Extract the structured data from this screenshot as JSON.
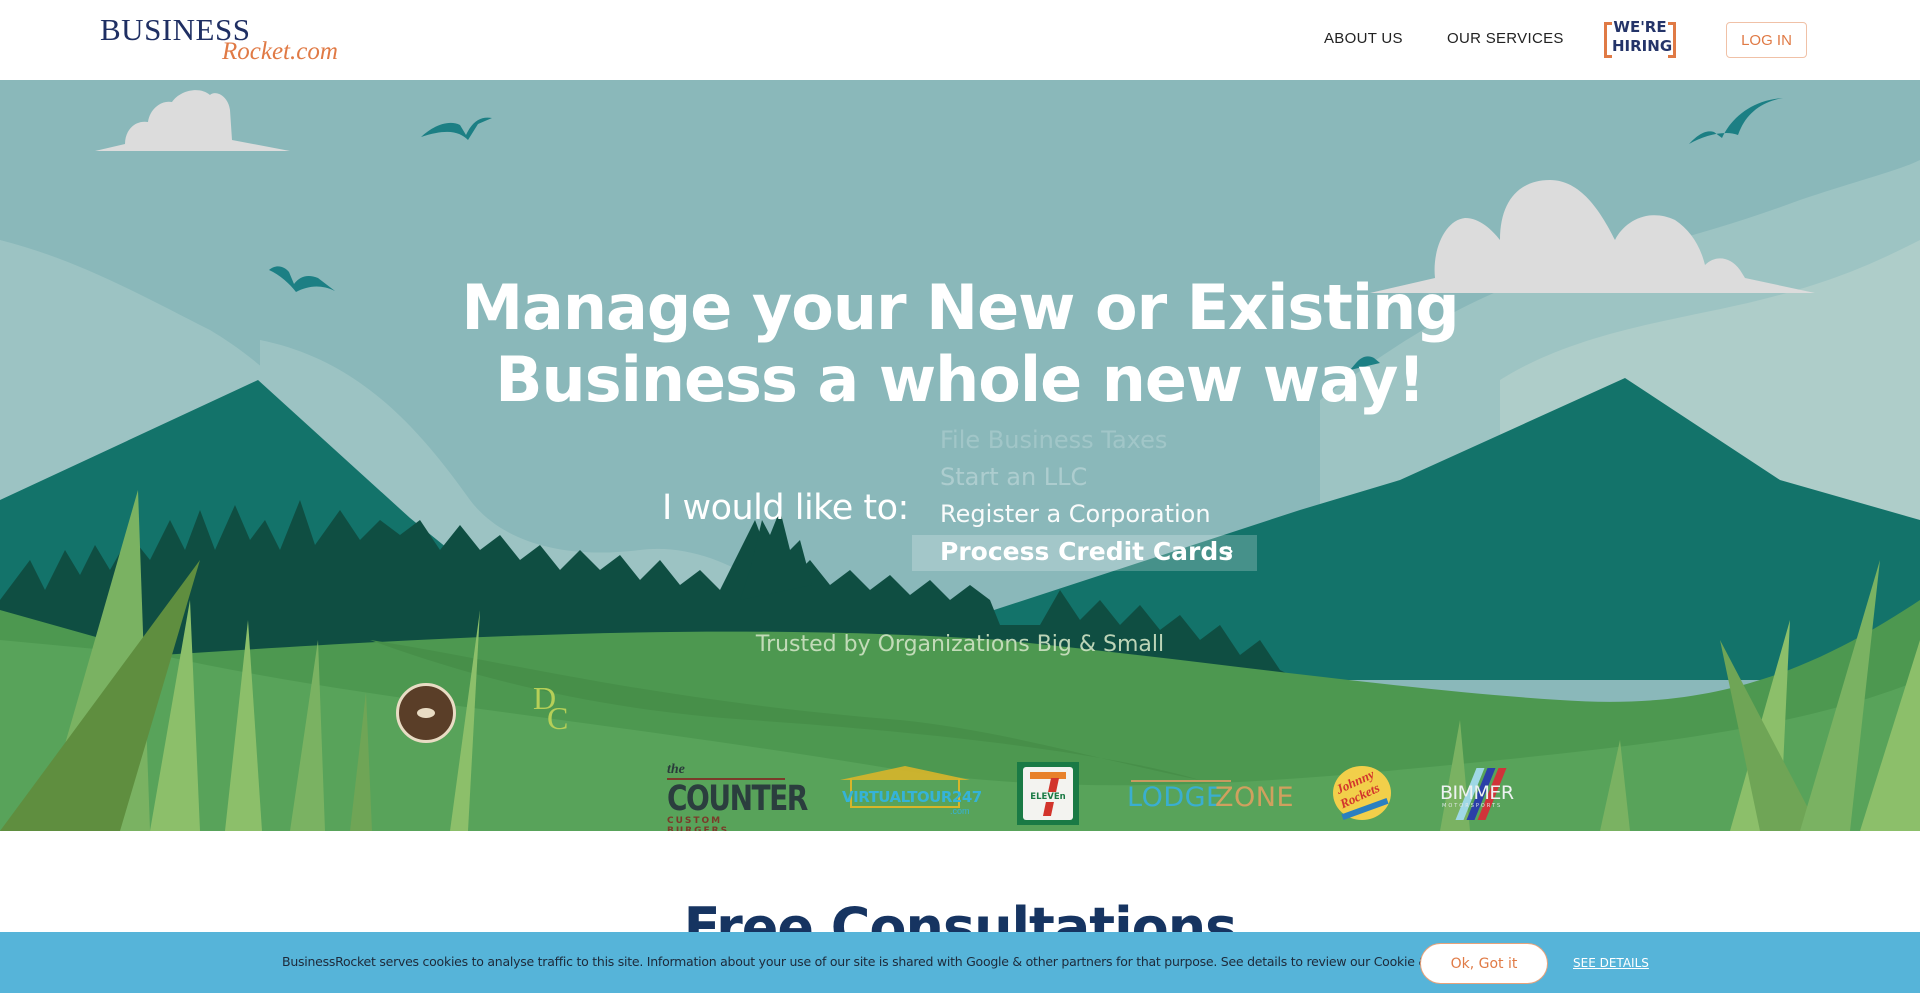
{
  "header": {
    "logo_top": "BUSINESS",
    "logo_bottom": "Rocket.com",
    "nav": [
      {
        "label": "ABOUT US"
      },
      {
        "label": "OUR SERVICES"
      }
    ],
    "hiring_badge": "WE'RE HIRING",
    "login_label": "LOG IN"
  },
  "hero": {
    "headline_line1": "Manage your New or Existing",
    "headline_line2": "Business a whole new way!",
    "prompt_label": "I would like to:",
    "options": [
      {
        "label": "File Business Taxes"
      },
      {
        "label": "Start an LLC"
      },
      {
        "label": "Register a Corporation"
      },
      {
        "label": "Process Credit Cards",
        "active": true
      }
    ],
    "trusted_label": "Trusted by Organizations Big & Small",
    "client_logos": [
      {
        "name": "The Coffee Bean & Tea Leaf"
      },
      {
        "name": "DPC"
      },
      {
        "name": "the COUNTER Custom Burgers",
        "line1": "the",
        "line2": "COUNTER",
        "line3": "CUSTOM BURGERS"
      },
      {
        "name": "VirtualTour247.com",
        "text": "VIRTUALTOUR247",
        "sub": ".com"
      },
      {
        "name": "7-Eleven",
        "text": "ELEVEn"
      },
      {
        "name": "LodgeZone",
        "text_a": "LODGE",
        "text_b": "ZONE"
      },
      {
        "name": "Johnny Rockets",
        "text_a": "Johnny",
        "text_b": "Rockets"
      },
      {
        "name": "Bimmer Motorsports",
        "text": "BIMMER",
        "sub": "MOTORSPORTS"
      }
    ],
    "colors": {
      "sky": "#8ab8ba",
      "mountain": "#13736a",
      "trees": "#0f4e42",
      "grass": "#4f9a52"
    }
  },
  "section": {
    "title": "Free Consultations"
  },
  "cookie_banner": {
    "text": "BusinessRocket serves cookies to analyse traffic to this site. Information about your use of our site is shared with Google & other partners for that purpose. See details to review our Cookie & Privacy Policy",
    "ok_label": "Ok, Got it",
    "details_label": "SEE DETAILS"
  }
}
